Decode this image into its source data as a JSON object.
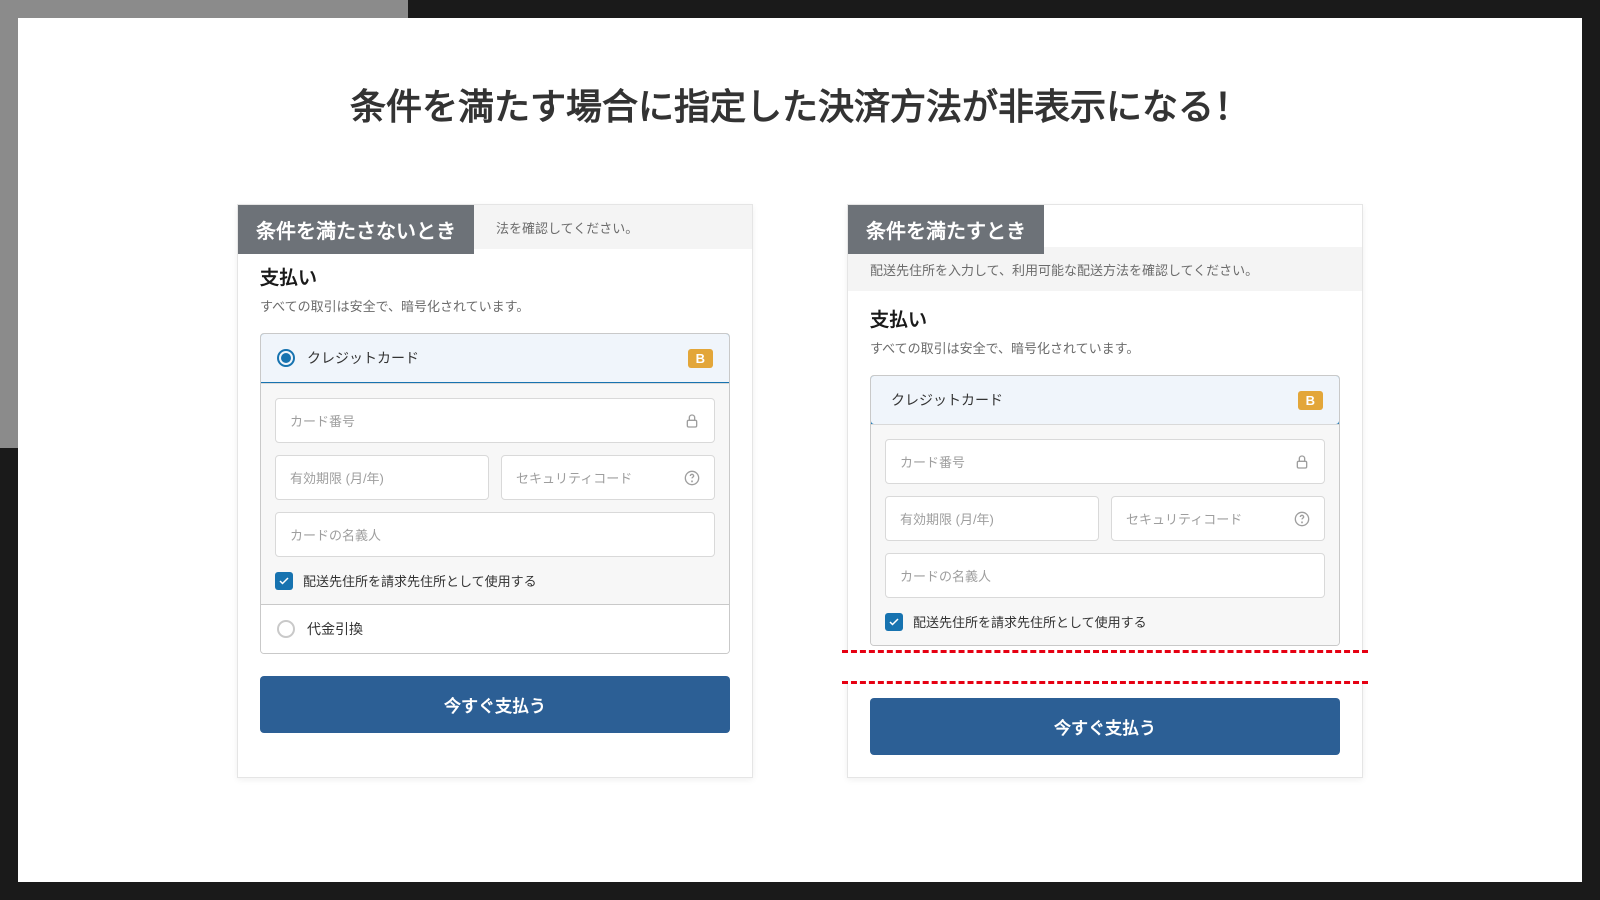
{
  "page_title": "条件を満たす場合に指定した決済方法が非表示になる！",
  "left": {
    "tag": "条件を満たさないとき",
    "info_partial": "法を確認してください。",
    "section_title": "支払い",
    "section_subtitle": "すべての取引は安全で、暗号化されています。",
    "credit_card_label": "クレジットカード",
    "b_badge": "B",
    "card_number_ph": "カード番号",
    "expiry_ph": "有効期限 (月/年)",
    "cvv_ph": "セキュリティコード",
    "name_ph": "カードの名義人",
    "billing_checkbox": "配送先住所を請求先住所として使用する",
    "cod_label": "代金引換",
    "pay_button": "今すぐ支払う"
  },
  "right": {
    "tag": "条件を満たすとき",
    "info": "配送先住所を入力して、利用可能な配送方法を確認してください。",
    "section_title": "支払い",
    "section_subtitle": "すべての取引は安全で、暗号化されています。",
    "credit_card_label": "クレジットカード",
    "b_badge": "B",
    "card_number_ph": "カード番号",
    "expiry_ph": "有効期限 (月/年)",
    "cvv_ph": "セキュリティコード",
    "name_ph": "カードの名義人",
    "billing_checkbox": "配送先住所を請求先住所として使用する",
    "pay_button": "今すぐ支払う"
  }
}
